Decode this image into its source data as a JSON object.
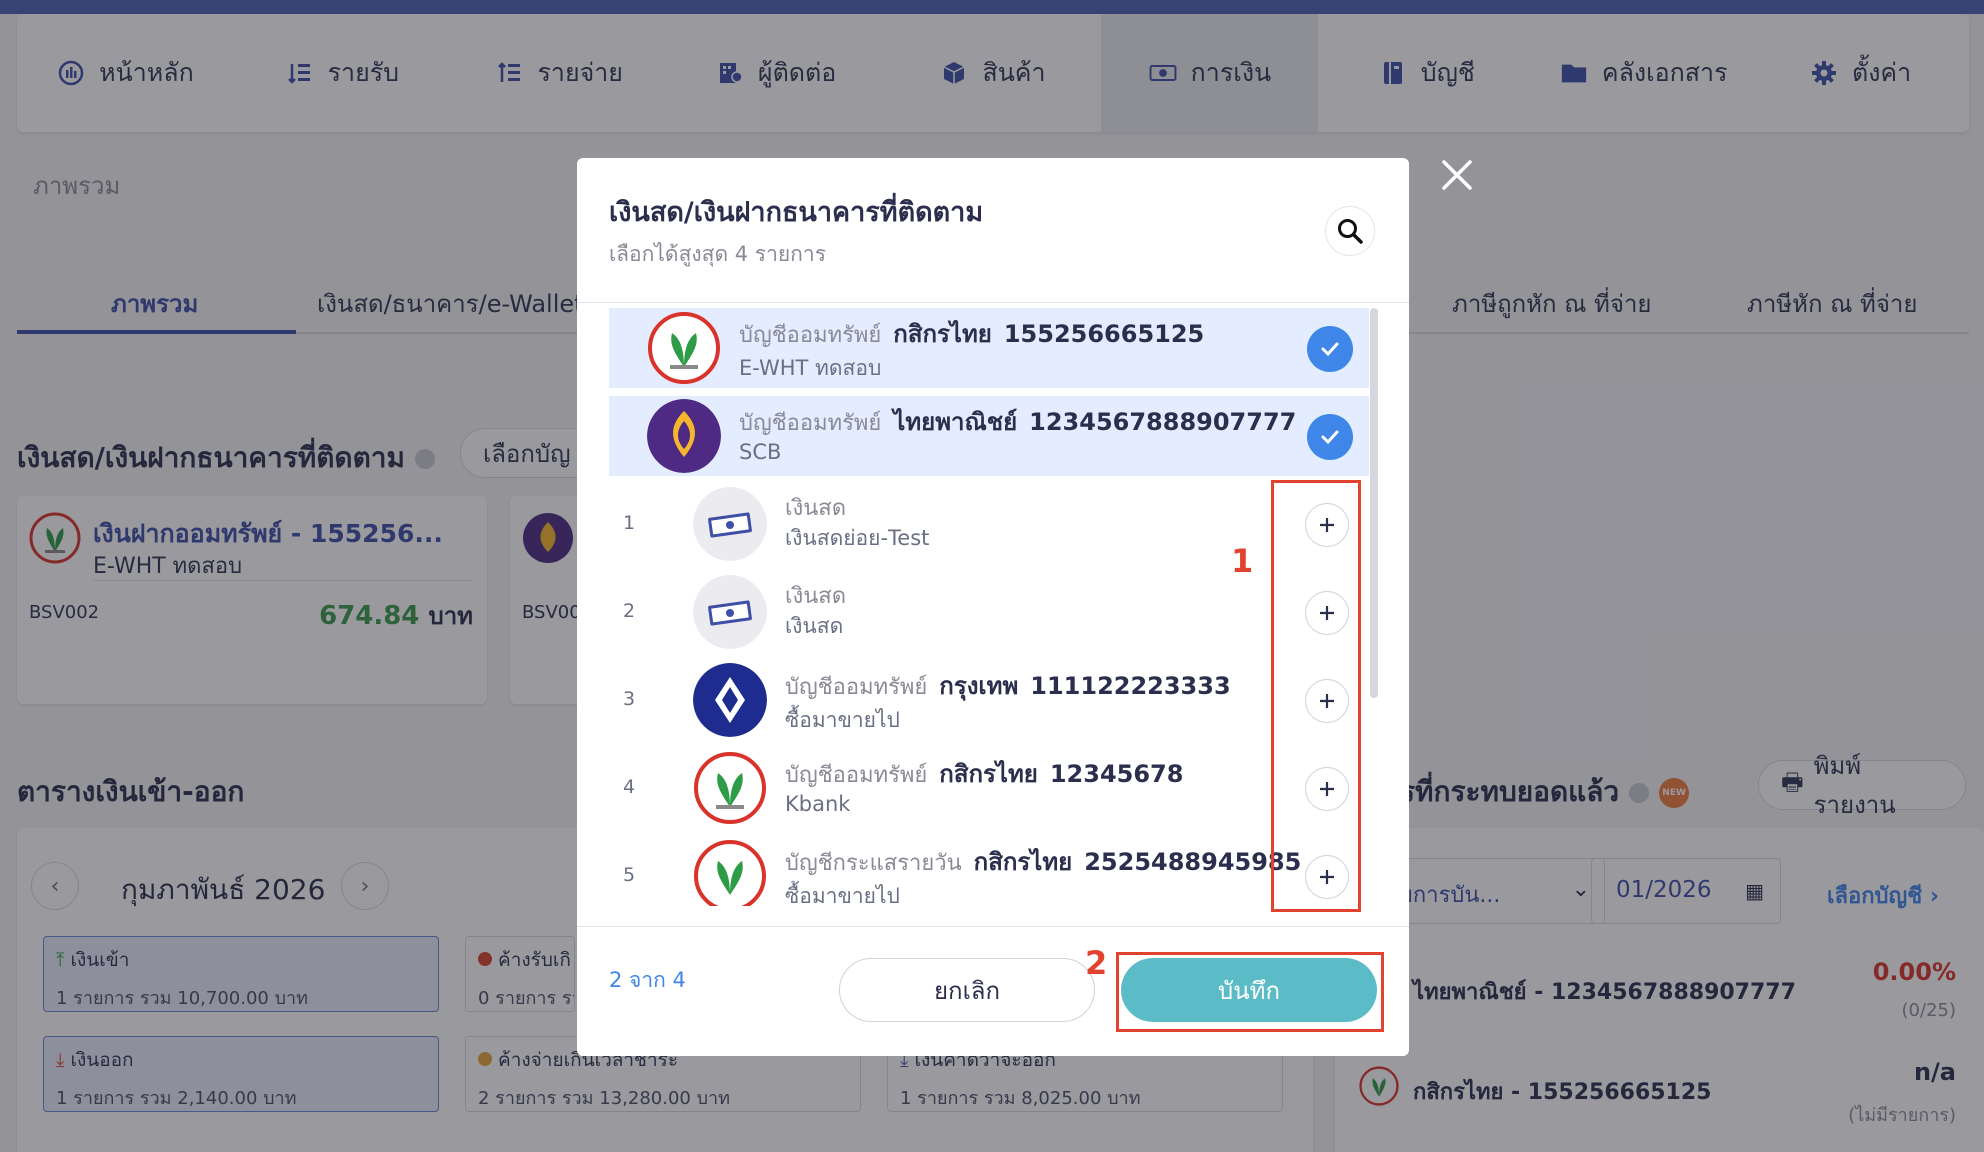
{
  "nav": {
    "items": [
      {
        "label": "หน้าหลัก",
        "icon": "dashboard-icon"
      },
      {
        "label": "รายรับ",
        "icon": "income-icon"
      },
      {
        "label": "รายจ่าย",
        "icon": "expense-icon"
      },
      {
        "label": "ผู้ติดต่อ",
        "icon": "contacts-icon"
      },
      {
        "label": "สินค้า",
        "icon": "box-icon"
      },
      {
        "label": "การเงิน",
        "icon": "money-icon"
      },
      {
        "label": "บัญชี",
        "icon": "ledger-icon"
      },
      {
        "label": "คลังเอกสาร",
        "icon": "folder-icon"
      },
      {
        "label": "ตั้งค่า",
        "icon": "gear-icon"
      }
    ],
    "active": "การเงิน"
  },
  "breadcrumb": "ภาพรวม",
  "tabs": {
    "overview": "ภาพรวม",
    "cash_bank": "เงินสด/ธนาคาร/e-Wallet",
    "wht_deducted": "ภาษีถูกหัก ณ ที่จ่าย",
    "wht_paid": "ภาษีหัก ณ ที่จ่าย"
  },
  "tracked_section": {
    "title": "เงินสด/เงินฝากธนาคารที่ติดตาม",
    "select_button": "เลือกบัญ",
    "card1": {
      "title": "เงินฝากออมทรัพย์ - 155256...",
      "sub": "E-WHT ทดสอบ",
      "code": "BSV002",
      "amount": "674.84",
      "unit": "บาท"
    },
    "card2": {
      "code": "BSV00"
    }
  },
  "cashflow_section": {
    "title": "ตารางเงินเข้า-ออก",
    "month": "กุมภาพันธ์ 2026",
    "boxes": {
      "in": {
        "title": "เงินเข้า",
        "sub": "1 รายการ รวม 10,700.00 บาท"
      },
      "receivable": {
        "title": "ค้างรับเกิ",
        "sub": "0 รายการ รวม"
      },
      "out": {
        "title": "เงินออก",
        "sub": "1 รายการ รวม 2,140.00 บาท"
      },
      "payable_overdue": {
        "title": "ค้างจ่ายเกินเวลาชำระ",
        "sub": "2 รายการ รวม 13,280.00 บาท"
      },
      "expected_out": {
        "title": "เงินคาดว่าจะออก",
        "sub": "1 รายการ รวม 8,025.00 บาท"
      }
    }
  },
  "reconcile_section": {
    "title": "รที่กระทบยอดแล้ว",
    "new_badge": "NEW",
    "print_button": "พิมพ์รายงาน",
    "filter_placeholder": "ยการบัน...",
    "period": "01/2026",
    "choose_account": "เลือกบัญชี",
    "rows": [
      {
        "name": "ไทยพาณิชย์ - 1234567888907777",
        "value": "0.00%",
        "sub": "(0/25)"
      },
      {
        "name": "กสิกรไทย - 155256665125",
        "value": "n/a",
        "sub": "(ไม่มีรายการ)"
      }
    ]
  },
  "modal": {
    "title": "เงินสด/เงินฝากธนาคารที่ติดตาม",
    "subtitle": "เลือกได้สูงสุด 4 รายการ",
    "selected": [
      {
        "type": "บัญชีออมทรัพย์",
        "bank": "กสิกรไทย",
        "account": "155256665125",
        "name": "E-WHT ทดสอบ",
        "logo": "kbank-logo"
      },
      {
        "type": "บัญชีออมทรัพย์",
        "bank": "ไทยพาณิชย์",
        "account": "1234567888907777",
        "name": "SCB",
        "logo": "scb-logo"
      }
    ],
    "available": [
      {
        "num": "1",
        "type": "เงินสด",
        "bank": "",
        "account": "",
        "name": "เงินสดย่อย-Test",
        "logo": "cash-logo"
      },
      {
        "num": "2",
        "type": "เงินสด",
        "bank": "",
        "account": "",
        "name": "เงินสด",
        "logo": "cash-logo"
      },
      {
        "num": "3",
        "type": "บัญชีออมทรัพย์",
        "bank": "กรุงเทพ",
        "account": "111122223333",
        "name": "ซื้อมาขายไป",
        "logo": "bbl-logo"
      },
      {
        "num": "4",
        "type": "บัญชีออมทรัพย์",
        "bank": "กสิกรไทย",
        "account": "12345678",
        "name": "Kbank",
        "logo": "kbank-logo"
      },
      {
        "num": "5",
        "type": "บัญชีกระแสรายวัน",
        "bank": "กสิกรไทย",
        "account": "2525488945985",
        "name": "ซื้อมาขายไป",
        "logo": "kbank-logo"
      }
    ],
    "count": "2 จาก 4",
    "cancel": "ยกเลิก",
    "save": "บันทึก",
    "annotations": {
      "one": "1",
      "two": "2"
    }
  },
  "colors": {
    "primary": "#3f4fa6",
    "save": "#5bbcc7",
    "check": "#3f86e8",
    "annotation": "#e2432e",
    "selected_row": "#e3edff"
  }
}
